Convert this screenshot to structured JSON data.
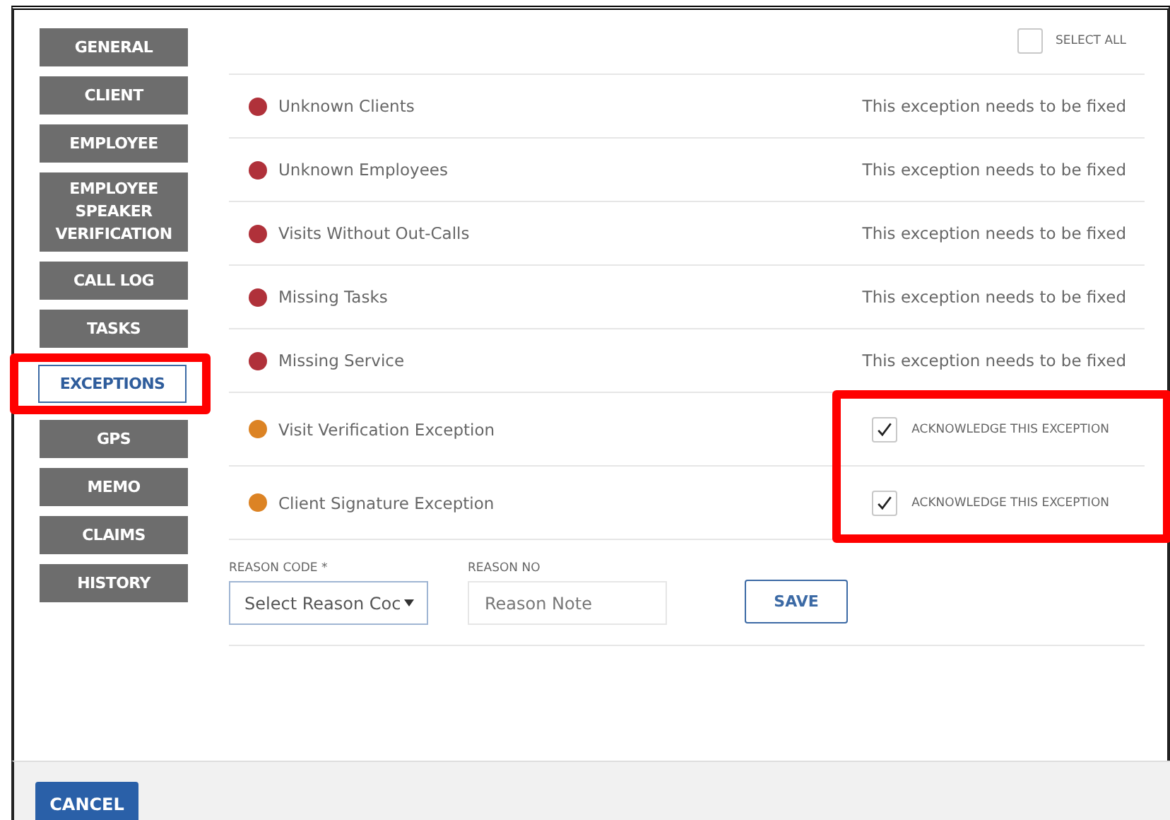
{
  "sidebar": {
    "items": [
      {
        "label": "GENERAL",
        "selected": false,
        "highlighted": false
      },
      {
        "label": "CLIENT",
        "selected": false,
        "highlighted": false
      },
      {
        "label": "EMPLOYEE",
        "selected": false,
        "highlighted": false
      },
      {
        "label": "EMPLOYEE SPEAKER VERIFICATION",
        "selected": false,
        "highlighted": false
      },
      {
        "label": "CALL LOG",
        "selected": false,
        "highlighted": false
      },
      {
        "label": "TASKS",
        "selected": false,
        "highlighted": false
      },
      {
        "label": "EXCEPTIONS",
        "selected": true,
        "highlighted": true
      },
      {
        "label": "GPS",
        "selected": false,
        "highlighted": false
      },
      {
        "label": "MEMO",
        "selected": false,
        "highlighted": false
      },
      {
        "label": "CLAIMS",
        "selected": false,
        "highlighted": false
      },
      {
        "label": "HISTORY",
        "selected": false,
        "highlighted": false
      }
    ]
  },
  "select_all": {
    "label": "SELECT ALL",
    "checked": false
  },
  "exceptions": [
    {
      "name": "Unknown Clients",
      "color": "#b0313a",
      "kind": "status",
      "status": "This exception needs to be fixed"
    },
    {
      "name": "Unknown Employees",
      "color": "#b0313a",
      "kind": "status",
      "status": "This exception needs to be fixed"
    },
    {
      "name": "Visits Without Out-Calls",
      "color": "#b0313a",
      "kind": "status",
      "status": "This exception needs to be fixed"
    },
    {
      "name": "Missing Tasks",
      "color": "#b0313a",
      "kind": "status",
      "status": "This exception needs to be fixed"
    },
    {
      "name": "Missing Service",
      "color": "#b0313a",
      "kind": "status",
      "status": "This exception needs to be fixed"
    },
    {
      "name": "Visit Verification Exception",
      "color": "#dc8324",
      "kind": "acknowledge",
      "label": "ACKNOWLEDGE THIS EXCEPTION",
      "checked": true,
      "highlighted": true
    },
    {
      "name": "Client Signature Exception",
      "color": "#dc8324",
      "kind": "acknowledge",
      "label": "ACKNOWLEDGE THIS EXCEPTION",
      "checked": true,
      "highlighted": true
    }
  ],
  "reason_code": {
    "label": "REASON CODE *",
    "value": "Select Reason Coc"
  },
  "reason_note": {
    "label": "REASON NO",
    "placeholder": "Reason Note"
  },
  "save_button": "SAVE",
  "cancel_button": "CANCEL"
}
